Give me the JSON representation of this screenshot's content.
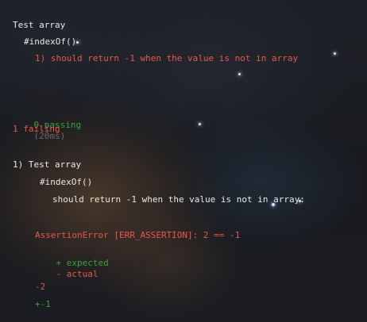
{
  "suite": {
    "title": "Test array",
    "describe": "#indexOf()",
    "failed_test": "1) should return -1 when the value is not in array"
  },
  "summary": {
    "passing": "0 passing",
    "duration": "(20ms)",
    "failing": "1 failing"
  },
  "failure_detail": {
    "header": "1) Test array",
    "describe": "#indexOf()",
    "test": "should return -1 when the value is not in array:",
    "error": "AssertionError [ERR_ASSERTION]: 2 == -1",
    "legend_plus": "+ expected",
    "legend_minus": "- actual",
    "diff_actual": "-2",
    "diff_expected": "+-1"
  },
  "colors": {
    "text": "#e8e8e8",
    "fail": "#e8574f",
    "pass": "#3aa33a",
    "muted": "#6b6b6b"
  }
}
